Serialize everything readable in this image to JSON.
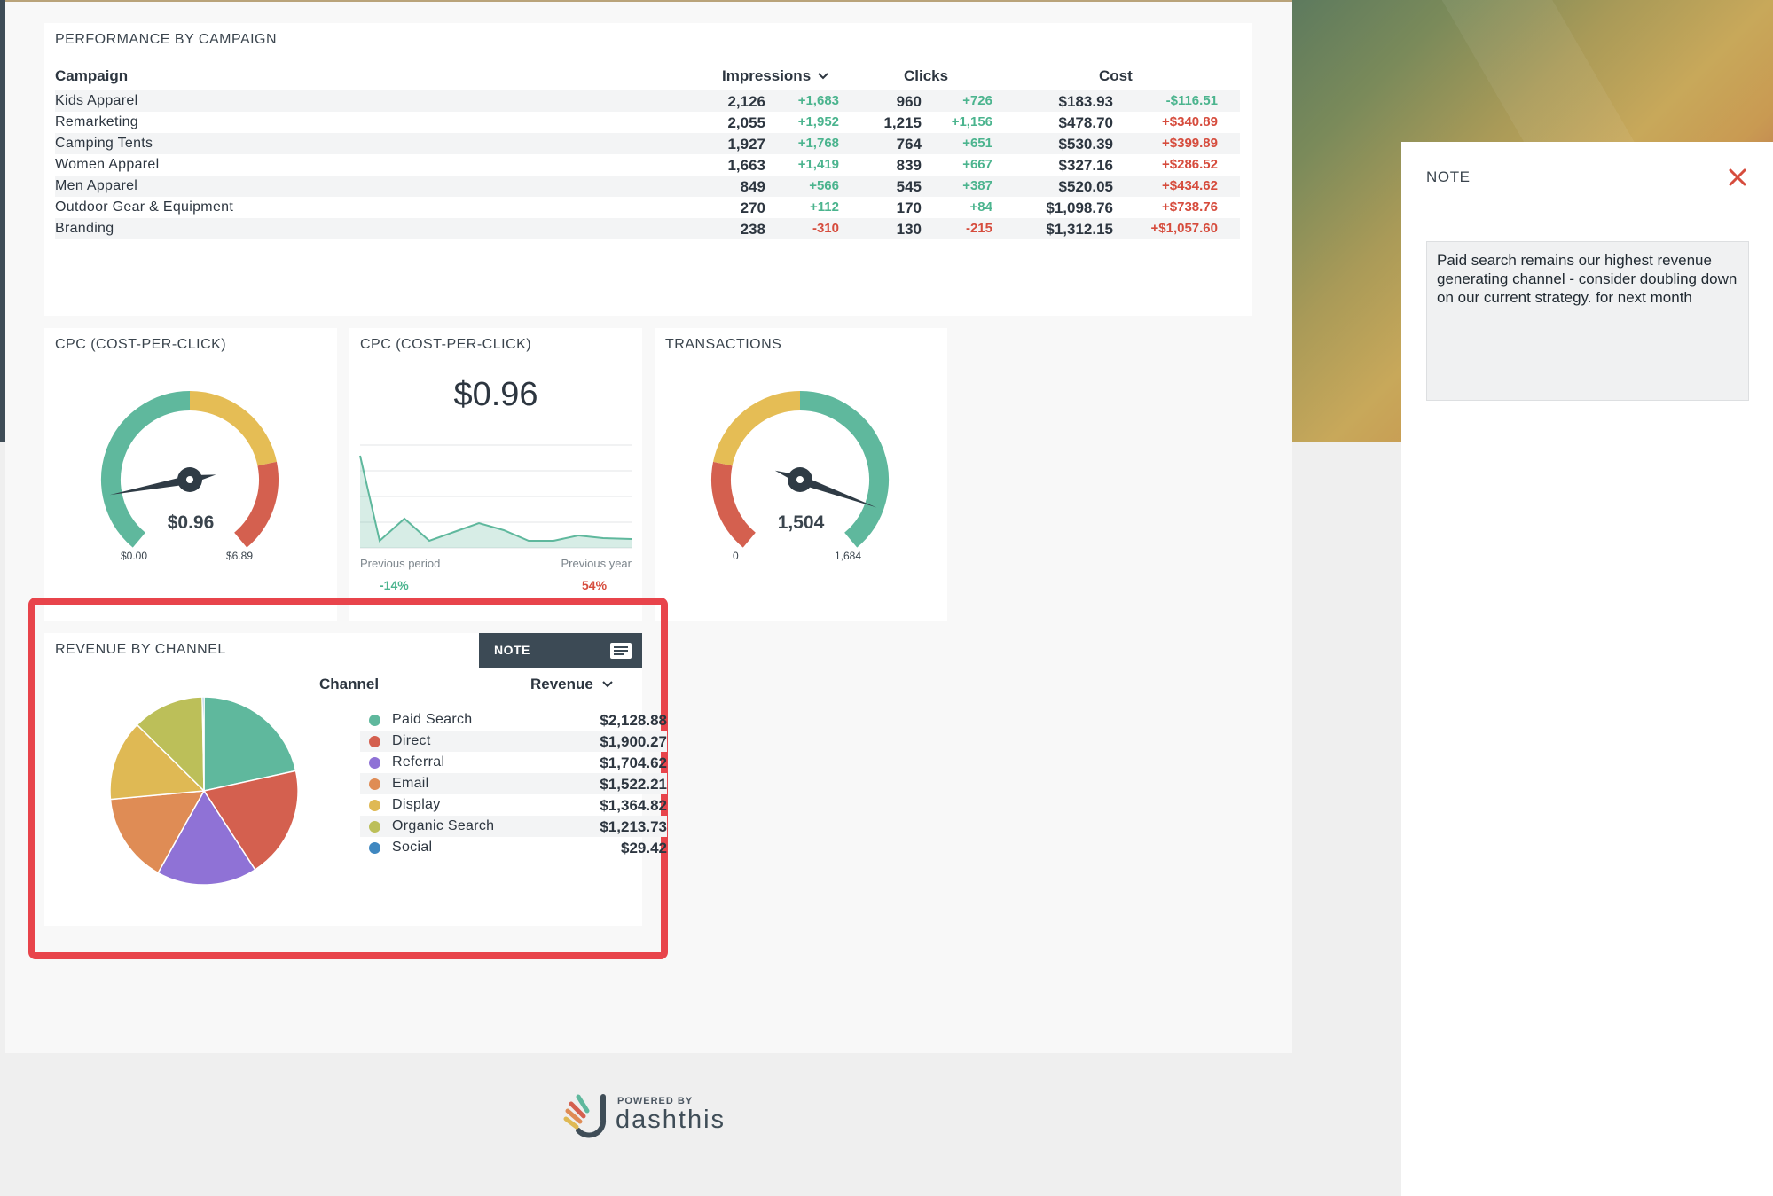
{
  "performance": {
    "title": "PERFORMANCE BY CAMPAIGN",
    "columns": {
      "campaign": "Campaign",
      "impressions": "Impressions",
      "clicks": "Clicks",
      "cost": "Cost"
    },
    "rows": [
      {
        "name": "Kids Apparel",
        "impressions": "2,126",
        "impressions_delta": "+1,683",
        "clicks": "960",
        "clicks_delta": "+726",
        "cost": "$183.93",
        "cost_delta": "-$116.51"
      },
      {
        "name": "Remarketing",
        "impressions": "2,055",
        "impressions_delta": "+1,952",
        "clicks": "1,215",
        "clicks_delta": "+1,156",
        "cost": "$478.70",
        "cost_delta": "+$340.89"
      },
      {
        "name": "Camping Tents",
        "impressions": "1,927",
        "impressions_delta": "+1,768",
        "clicks": "764",
        "clicks_delta": "+651",
        "cost": "$530.39",
        "cost_delta": "+$399.89"
      },
      {
        "name": "Women Apparel",
        "impressions": "1,663",
        "impressions_delta": "+1,419",
        "clicks": "839",
        "clicks_delta": "+667",
        "cost": "$327.16",
        "cost_delta": "+$286.52"
      },
      {
        "name": "Men Apparel",
        "impressions": "849",
        "impressions_delta": "+566",
        "clicks": "545",
        "clicks_delta": "+387",
        "cost": "$520.05",
        "cost_delta": "+$434.62"
      },
      {
        "name": "Outdoor Gear & Equipment",
        "impressions": "270",
        "impressions_delta": "+112",
        "clicks": "170",
        "clicks_delta": "+84",
        "cost": "$1,098.76",
        "cost_delta": "+$738.76"
      },
      {
        "name": "Branding",
        "impressions": "238",
        "impressions_delta": "-310",
        "clicks": "130",
        "clicks_delta": "-215",
        "cost": "$1,312.15",
        "cost_delta": "+$1,057.60"
      }
    ]
  },
  "cpc_gauge": {
    "title": "CPC (COST-PER-CLICK)",
    "value": "$0.96",
    "min": "$0.00",
    "max": "$6.89",
    "fraction": 0.14
  },
  "cpc_trend": {
    "title": "CPC (COST-PER-CLICK)",
    "value": "$0.96",
    "previous_period_label": "Previous period",
    "previous_period_value": "-14%",
    "previous_year_label": "Previous year",
    "previous_year_value": "54%"
  },
  "transactions": {
    "title": "TRANSACTIONS",
    "value": "1,504",
    "min": "0",
    "max": "1,684",
    "fraction": 0.893
  },
  "revenue": {
    "title": "REVENUE BY CHANNEL",
    "note_button": "NOTE",
    "channel_header": "Channel",
    "revenue_header": "Revenue",
    "channels": [
      {
        "name": "Paid Search",
        "value": "$2,128.88",
        "amount": 2128.88,
        "color": "#5fb89d"
      },
      {
        "name": "Direct",
        "value": "$1,900.27",
        "amount": 1900.27,
        "color": "#d4604f"
      },
      {
        "name": "Referral",
        "value": "$1,704.62",
        "amount": 1704.62,
        "color": "#8f72d6"
      },
      {
        "name": "Email",
        "value": "$1,522.21",
        "amount": 1522.21,
        "color": "#df8c55"
      },
      {
        "name": "Display",
        "value": "$1,364.82",
        "amount": 1364.82,
        "color": "#dfb954"
      },
      {
        "name": "Organic Search",
        "value": "$1,213.73",
        "amount": 1213.73,
        "color": "#bcbf59"
      },
      {
        "name": "Social",
        "value": "$29.42",
        "amount": 29.42,
        "color": "#3f87c0"
      }
    ]
  },
  "footer": {
    "powered_by": "POWERED BY",
    "brand": "dashthis"
  },
  "note_panel": {
    "title": "NOTE",
    "text": "Paid search remains our highest revenue generating channel - consider doubling down on our current strategy. for next month"
  },
  "colors": {
    "green": "#5fb89d",
    "yellow": "#e5bd55",
    "red": "#d4604f",
    "dark": "#2f3b45",
    "highlight": "#e8444b"
  }
}
